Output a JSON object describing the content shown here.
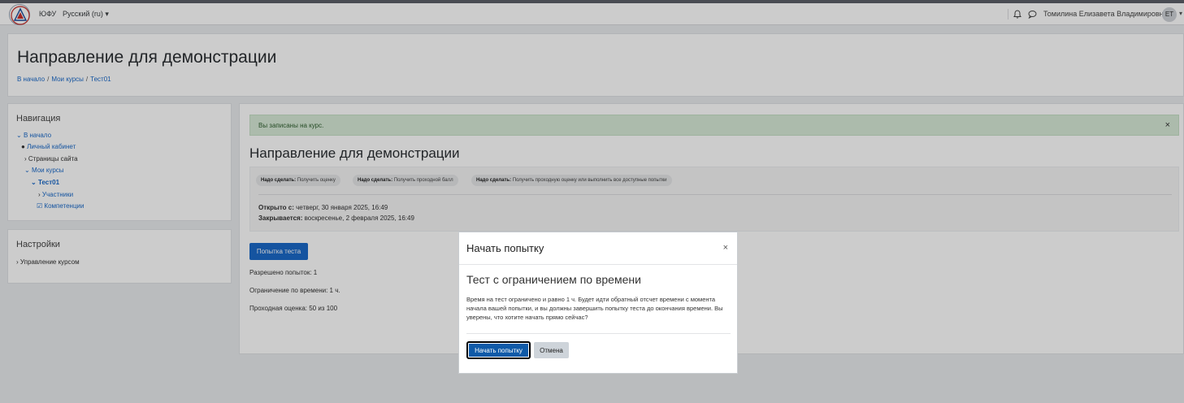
{
  "navbar": {
    "site_name": "ЮФУ",
    "language": "Русский (ru) ▾",
    "user_name": "Томилина Елизавета Владимировна",
    "avatar_initials": "ЕТ"
  },
  "header": {
    "title": "Направление для демонстрации",
    "breadcrumb": [
      "В начало",
      "Мои курсы",
      "Тест01"
    ]
  },
  "nav_block": {
    "title": "Навигация",
    "items": [
      {
        "label": "В начало"
      },
      {
        "label": "Личный кабинет"
      },
      {
        "label": "Страницы сайта"
      },
      {
        "label": "Мои курсы"
      },
      {
        "label": "Тест01"
      },
      {
        "label": "Участники"
      },
      {
        "label": "Компетенции"
      }
    ]
  },
  "settings_block": {
    "title": "Настройки",
    "items": [
      {
        "label": "Управление курсом"
      }
    ]
  },
  "main": {
    "alert": "Вы записаны на курс.",
    "title": "Направление для демонстрации",
    "todo_prefix": "Надо сделать:",
    "todos": [
      "Получить оценку",
      "Получить проходной балл",
      "Получить проходную оценку или выполнить все доступные попытки"
    ],
    "opened_label": "Открыто с:",
    "opened_value": "четверг, 30 января 2025, 16:49",
    "closes_label": "Закрывается:",
    "closes_value": "воскресенье, 2 февраля 2025, 16:49",
    "attempt_button": "Попытка теста",
    "info": [
      "Разрешено попыток: 1",
      "Ограничение по времени: 1 ч.",
      "Проходная оценка: 50 из 100"
    ]
  },
  "modal": {
    "title": "Начать попытку",
    "heading": "Тест с ограничением по времени",
    "text": "Время на тест ограничено и равно 1 ч. Будет идти обратный отсчет времени с момента начала вашей попытки, и вы должны завершить попытку теста до окончания времени. Вы уверены, что хотите начать прямо сейчас?",
    "start_button": "Начать попытку",
    "cancel_button": "Отмена"
  },
  "colors": {
    "primary": "#1b6ac9",
    "alert_bg": "#d8ead8",
    "page_bg": "#e9ebee"
  }
}
